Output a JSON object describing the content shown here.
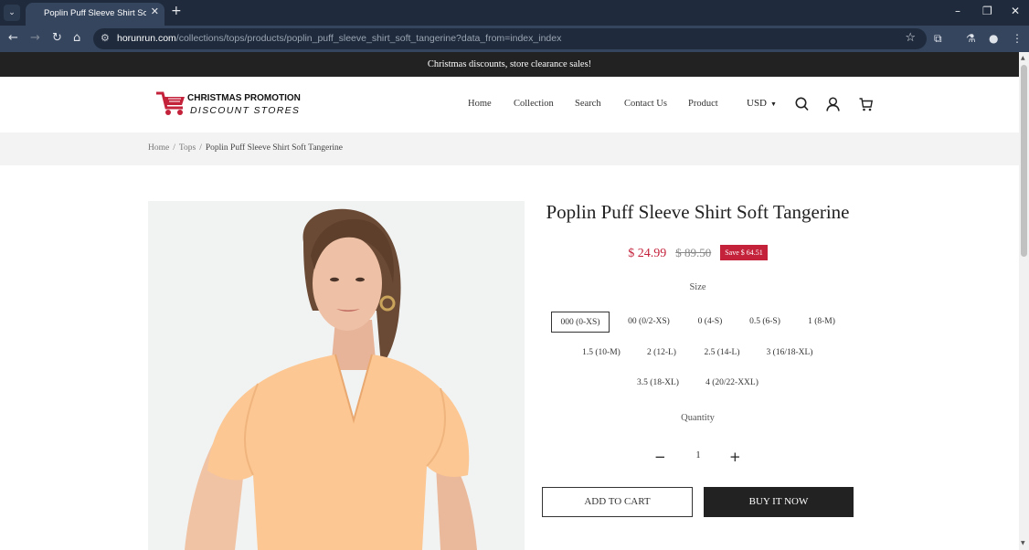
{
  "browser": {
    "tab_title": "Poplin Puff Sleeve Shirt Soft Tangerine",
    "url_host": "horunrun.com",
    "url_path": "/collections/tops/products/poplin_puff_sleeve_shirt_soft_tangerine?data_from=index_index"
  },
  "promo": {
    "text": "Christmas discounts, store clearance sales!"
  },
  "logo": {
    "line1": "CHRISTMAS PROMOTION",
    "line2": "DISCOUNT STORES"
  },
  "nav": {
    "items": [
      "Home",
      "Collection",
      "Search",
      "Contact Us",
      "Product"
    ],
    "currency": "USD"
  },
  "breadcrumb": {
    "home": "Home",
    "category": "Tops",
    "current": "Poplin Puff Sleeve Shirt Soft Tangerine"
  },
  "product": {
    "title": "Poplin Puff Sleeve Shirt Soft Tangerine",
    "price": "$ 24.99",
    "old_price": "$ 89.50",
    "save_badge": "Save $ 64.51",
    "size_label": "Size",
    "sizes": [
      "000 (0-XS)",
      "00 (0/2-XS)",
      "0 (4-S)",
      "0.5 (6-S)",
      "1 (8-M)",
      "1.5 (10-M)",
      "2 (12-L)",
      "2.5 (14-L)",
      "3 (16/18-XL)",
      "3.5 (18-XL)",
      "4 (20/22-XXL)"
    ],
    "selected_size": "000 (0-XS)",
    "quantity_label": "Quantity",
    "quantity": "1",
    "add_to_cart": "ADD TO CART",
    "buy_now": "BUY IT NOW"
  },
  "colors": {
    "accent": "#c4223b",
    "dark": "#222222",
    "chrome": "#35455e",
    "shirt": "#fcc792"
  }
}
